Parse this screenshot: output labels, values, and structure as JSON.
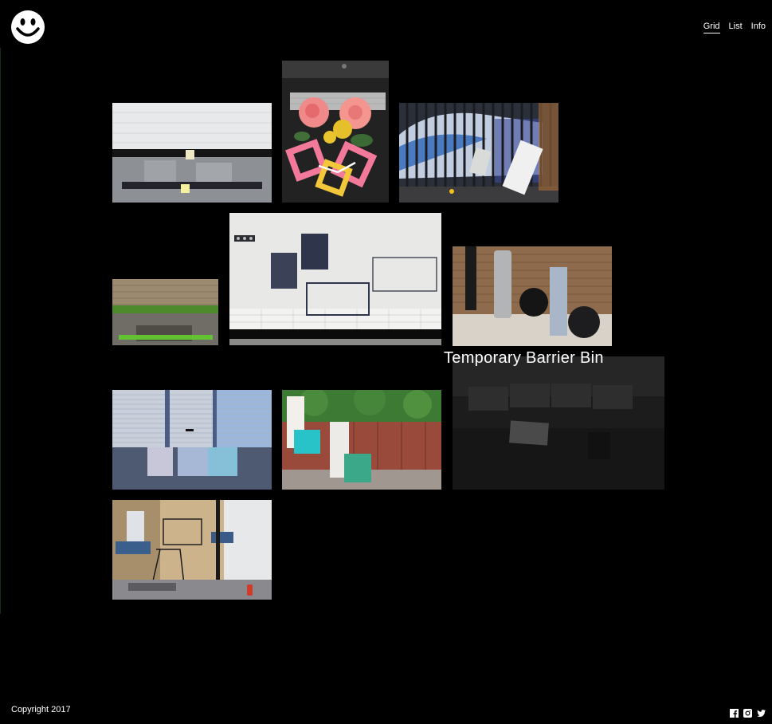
{
  "header": {
    "logo_icon": "smiley-face-icon",
    "nav": [
      {
        "label": "Grid",
        "active": true
      },
      {
        "label": "List",
        "active": false
      },
      {
        "label": "Info",
        "active": false
      }
    ]
  },
  "gallery": {
    "hover_title": "Temporary Barrier Bin"
  },
  "footer": {
    "copyright": "Copyright 2017",
    "social_icons": [
      "facebook-icon",
      "instagram-icon",
      "twitter-icon"
    ]
  }
}
